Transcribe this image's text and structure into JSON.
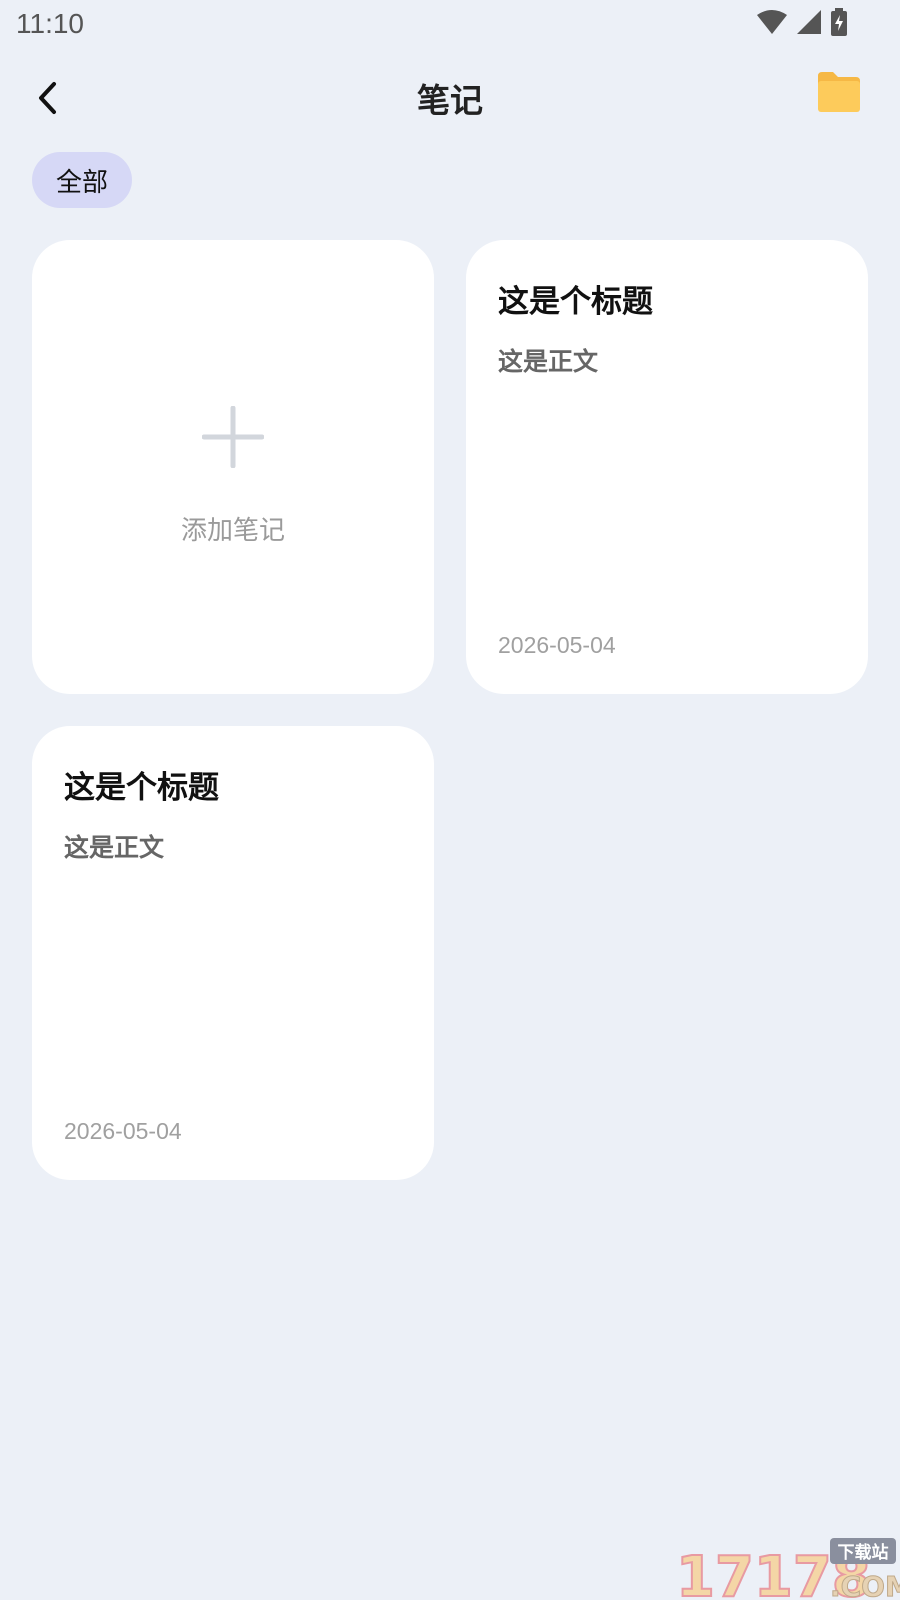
{
  "status_bar": {
    "time": "11:10",
    "icons": [
      "wifi-icon",
      "signal-icon",
      "battery-charging-icon"
    ]
  },
  "header": {
    "title": "笔记",
    "back_icon": "chevron-left-icon",
    "folder_icon": "folder-icon"
  },
  "filters": {
    "active": "全部"
  },
  "add_card": {
    "label": "添加笔记",
    "icon": "plus-icon"
  },
  "notes": [
    {
      "title": "这是个标题",
      "body": "这是正文",
      "date": "2026-05-04"
    },
    {
      "title": "这是个标题",
      "body": "这是正文",
      "date": "2026-05-04"
    }
  ],
  "watermark": {
    "text": "17178",
    "suffix": ".COM",
    "tag": "下载站"
  },
  "colors": {
    "background": "#ECF0F7",
    "card": "#FFFFFF",
    "chip": "#D6D8F6",
    "folder": "#FDCB5B",
    "muted_text": "#9A9A9A"
  }
}
